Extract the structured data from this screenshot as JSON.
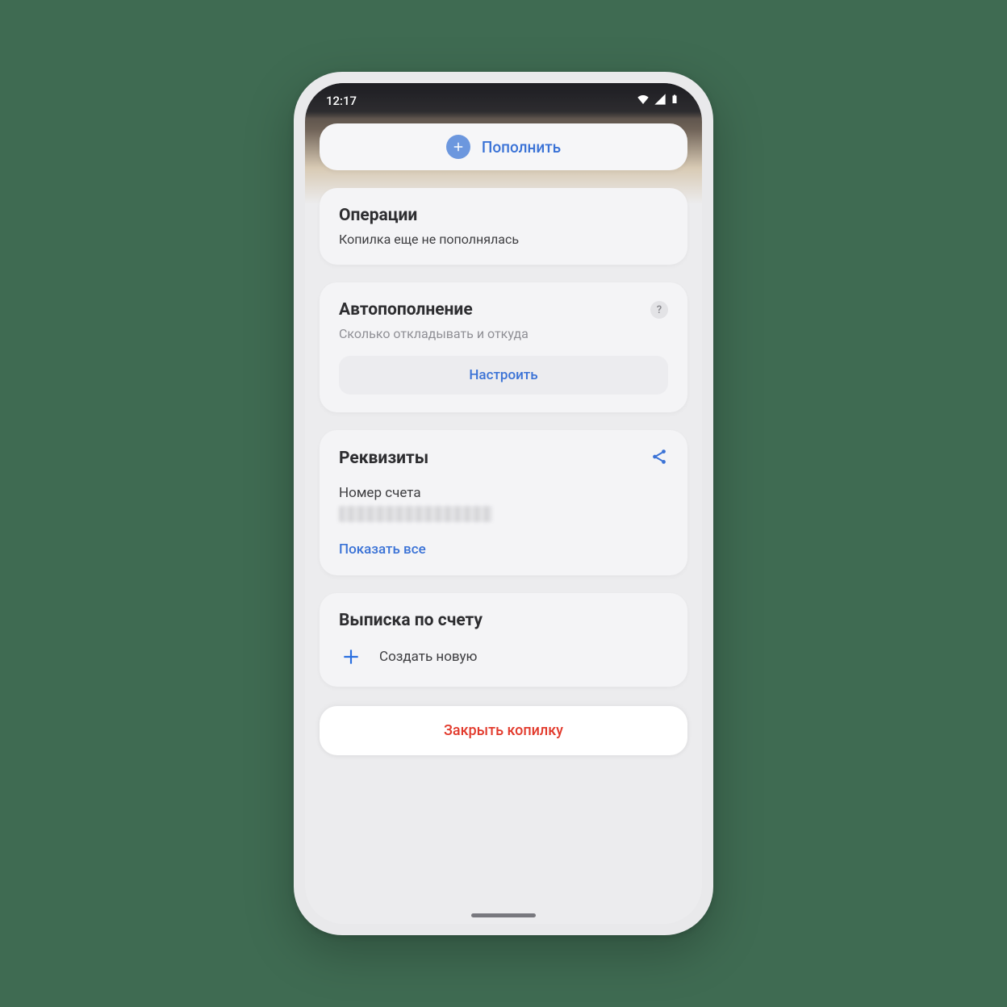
{
  "status": {
    "time": "12:17"
  },
  "topup": {
    "label": "Пополнить"
  },
  "ops": {
    "title": "Операции",
    "subtitle": "Копилка еще не пополнялась"
  },
  "auto": {
    "title": "Автопополнение",
    "subtitle": "Сколько откладывать и откуда",
    "configure": "Настроить",
    "help": "?"
  },
  "req": {
    "title": "Реквизиты",
    "account_label": "Номер счета",
    "show_all": "Показать все"
  },
  "statement": {
    "title": "Выписка по счету",
    "create_new": "Создать новую"
  },
  "close": {
    "label": "Закрыть копилку"
  }
}
